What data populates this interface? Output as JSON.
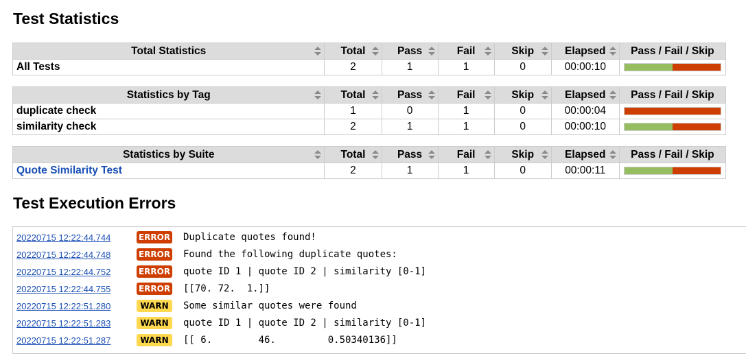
{
  "titles": {
    "statistics": "Test Statistics",
    "errors": "Test Execution Errors"
  },
  "columns": {
    "total": "Total",
    "pass": "Pass",
    "fail": "Fail",
    "skip": "Skip",
    "elapsed": "Elapsed",
    "graph": "Pass / Fail / Skip"
  },
  "colors": {
    "pass": "#97bd61",
    "fail": "#ce3e01",
    "warn": "#fed84f",
    "link": "#1a4fb5",
    "header_bg": "#dcdcdc"
  },
  "total_stats": {
    "header": "Total Statistics",
    "rows": [
      {
        "name": "All Tests",
        "total": "2",
        "pass": "1",
        "fail": "1",
        "skip": "0",
        "elapsed": "00:00:10",
        "pass_pct": 50,
        "fail_pct": 50,
        "skip_pct": 0
      }
    ]
  },
  "tag_stats": {
    "header": "Statistics by Tag",
    "rows": [
      {
        "name": "duplicate check",
        "total": "1",
        "pass": "0",
        "fail": "1",
        "skip": "0",
        "elapsed": "00:00:04",
        "pass_pct": 0,
        "fail_pct": 100,
        "skip_pct": 0
      },
      {
        "name": "similarity check",
        "total": "2",
        "pass": "1",
        "fail": "1",
        "skip": "0",
        "elapsed": "00:00:10",
        "pass_pct": 50,
        "fail_pct": 50,
        "skip_pct": 0
      }
    ]
  },
  "suite_stats": {
    "header": "Statistics by Suite",
    "rows": [
      {
        "name": "Quote Similarity Test",
        "total": "2",
        "pass": "1",
        "fail": "1",
        "skip": "0",
        "elapsed": "00:00:11",
        "pass_pct": 50,
        "fail_pct": 50,
        "skip_pct": 0
      }
    ]
  },
  "errors": [
    {
      "time": "20220715 12:22:44.744",
      "level": "ERROR",
      "message": "Duplicate quotes found!"
    },
    {
      "time": "20220715 12:22:44.748",
      "level": "ERROR",
      "message": "Found the following duplicate quotes:"
    },
    {
      "time": "20220715 12:22:44.752",
      "level": "ERROR",
      "message": "quote ID 1 | quote ID 2 | similarity [0-1]"
    },
    {
      "time": "20220715 12:22:44.755",
      "level": "ERROR",
      "message": "[[70. 72.  1.]]"
    },
    {
      "time": "20220715 12:22:51.280",
      "level": "WARN",
      "message": "Some similar quotes were found"
    },
    {
      "time": "20220715 12:22:51.283",
      "level": "WARN",
      "message": "quote ID 1 | quote ID 2 | similarity [0-1]"
    },
    {
      "time": "20220715 12:22:51.287",
      "level": "WARN",
      "message": "[[ 6.        46.         0.50340136]]"
    }
  ]
}
